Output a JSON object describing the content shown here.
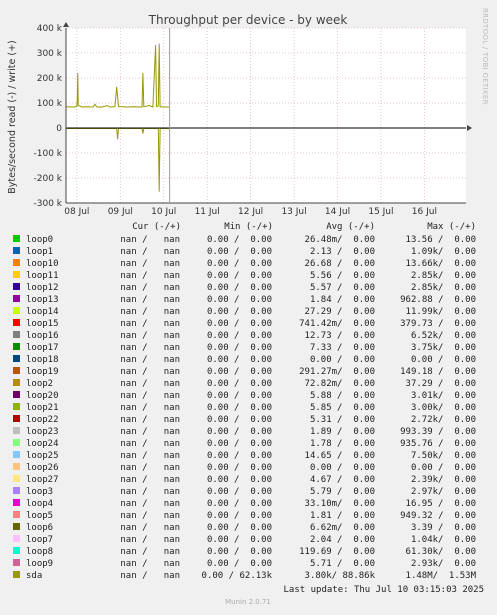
{
  "chart_data": {
    "type": "line",
    "title": "Throughput per device - by week",
    "ylabel": "Bytes/second read (-) / write (+)",
    "watermark": "RRDTOOL / TOBI OETIKER",
    "ylim": [
      -300000,
      400000
    ],
    "y_ticks": [
      {
        "value": 400000,
        "label": "400 k"
      },
      {
        "value": 300000,
        "label": "300 k"
      },
      {
        "value": 200000,
        "label": "200 k"
      },
      {
        "value": 100000,
        "label": "100 k"
      },
      {
        "value": 0,
        "label": "0"
      },
      {
        "value": -100000,
        "label": "-100 k"
      },
      {
        "value": -200000,
        "label": "-200 k"
      },
      {
        "value": -300000,
        "label": "-300 k"
      }
    ],
    "xlim": [
      "2025-07-07T18:00",
      "2025-07-16T23:00"
    ],
    "x_ticks": [
      {
        "value": "2025-07-08",
        "label": "08 Jul"
      },
      {
        "value": "2025-07-09",
        "label": "09 Jul"
      },
      {
        "value": "2025-07-10",
        "label": "10 Jul"
      },
      {
        "value": "2025-07-11",
        "label": "11 Jul"
      },
      {
        "value": "2025-07-12",
        "label": "12 Jul"
      },
      {
        "value": "2025-07-13",
        "label": "13 Jul"
      },
      {
        "value": "2025-07-14",
        "label": "14 Jul"
      },
      {
        "value": "2025-07-15",
        "label": "15 Jul"
      },
      {
        "value": "2025-07-16",
        "label": "16 Jul"
      }
    ],
    "now_marker": "2025-07-10T03:15",
    "grid": true,
    "series": [
      {
        "name": "sda",
        "color": "#999900",
        "write_points": [
          [
            "2025-07-07T18:00",
            85000
          ],
          [
            "2025-07-07T22:00",
            84000
          ],
          [
            "2025-07-08T00:00",
            86000
          ],
          [
            "2025-07-08T00:15",
            120000
          ],
          [
            "2025-07-08T00:30",
            220000
          ],
          [
            "2025-07-08T00:45",
            90000
          ],
          [
            "2025-07-08T03:00",
            84000
          ],
          [
            "2025-07-08T06:00",
            85000
          ],
          [
            "2025-07-08T09:00",
            84000
          ],
          [
            "2025-07-08T10:00",
            95000
          ],
          [
            "2025-07-08T11:00",
            84000
          ],
          [
            "2025-07-08T14:00",
            84000
          ],
          [
            "2025-07-08T17:00",
            90000
          ],
          [
            "2025-07-08T18:00",
            84000
          ],
          [
            "2025-07-08T21:00",
            85000
          ],
          [
            "2025-07-08T22:00",
            165000
          ],
          [
            "2025-07-08T23:00",
            86000
          ],
          [
            "2025-07-09T04:00",
            84000
          ],
          [
            "2025-07-09T08:00",
            85000
          ],
          [
            "2025-07-09T10:00",
            84000
          ],
          [
            "2025-07-09T12:00",
            84000
          ],
          [
            "2025-07-09T12:30",
            220000
          ],
          [
            "2025-07-09T13:00",
            85000
          ],
          [
            "2025-07-09T16:00",
            90000
          ],
          [
            "2025-07-09T18:00",
            84000
          ],
          [
            "2025-07-09T19:30",
            332000
          ],
          [
            "2025-07-09T20:00",
            86000
          ],
          [
            "2025-07-09T21:00",
            88000
          ],
          [
            "2025-07-09T21:30",
            338000
          ],
          [
            "2025-07-09T22:00",
            85000
          ],
          [
            "2025-07-10T00:00",
            84000
          ],
          [
            "2025-07-10T03:00",
            84000
          ]
        ],
        "read_points": [
          [
            "2025-07-07T18:00",
            -2000
          ],
          [
            "2025-07-08T00:00",
            -2000
          ],
          [
            "2025-07-08T22:00",
            -2000
          ],
          [
            "2025-07-08T22:30",
            -45000
          ],
          [
            "2025-07-08T23:00",
            -2000
          ],
          [
            "2025-07-09T12:00",
            -2000
          ],
          [
            "2025-07-09T12:30",
            -22000
          ],
          [
            "2025-07-09T13:00",
            -2000
          ],
          [
            "2025-07-09T21:00",
            -2000
          ],
          [
            "2025-07-09T21:30",
            -255000
          ],
          [
            "2025-07-09T22:00",
            -2000
          ],
          [
            "2025-07-10T00:00",
            -2000
          ],
          [
            "2025-07-10T03:00",
            -2000
          ]
        ]
      }
    ]
  },
  "legend": {
    "col_headers": {
      "cur": "Cur (-/+)",
      "min": "Min (-/+)",
      "avg": "Avg (-/+)",
      "max": "Max (-/+)"
    },
    "rows": [
      {
        "name": "loop0",
        "color": "#00cc00",
        "cur": "nan /   nan",
        "min": "0.00 /  0.00",
        "avg": "26.48m/  0.00",
        "max": "13.56 /  0.00"
      },
      {
        "name": "loop1",
        "color": "#0066b3",
        "cur": "nan /   nan",
        "min": "0.00 /  0.00",
        "avg": "2.13 /  0.00",
        "max": "1.09k/  0.00"
      },
      {
        "name": "loop10",
        "color": "#ff8000",
        "cur": "nan /   nan",
        "min": "0.00 /  0.00",
        "avg": "26.68 /  0.00",
        "max": "13.66k/  0.00"
      },
      {
        "name": "loop11",
        "color": "#ffcc00",
        "cur": "nan /   nan",
        "min": "0.00 /  0.00",
        "avg": "5.56 /  0.00",
        "max": "2.85k/  0.00"
      },
      {
        "name": "loop12",
        "color": "#330099",
        "cur": "nan /   nan",
        "min": "0.00 /  0.00",
        "avg": "5.57 /  0.00",
        "max": "2.85k/  0.00"
      },
      {
        "name": "loop13",
        "color": "#990099",
        "cur": "nan /   nan",
        "min": "0.00 /  0.00",
        "avg": "1.84 /  0.00",
        "max": "962.88 /  0.00"
      },
      {
        "name": "loop14",
        "color": "#ccff00",
        "cur": "nan /   nan",
        "min": "0.00 /  0.00",
        "avg": "27.29 /  0.00",
        "max": "11.99k/  0.00"
      },
      {
        "name": "loop15",
        "color": "#ff0000",
        "cur": "nan /   nan",
        "min": "0.00 /  0.00",
        "avg": "741.42m/  0.00",
        "max": "379.73 /  0.00"
      },
      {
        "name": "loop16",
        "color": "#808080",
        "cur": "nan /   nan",
        "min": "0.00 /  0.00",
        "avg": "12.73 /  0.00",
        "max": "6.52k/  0.00"
      },
      {
        "name": "loop17",
        "color": "#008f00",
        "cur": "nan /   nan",
        "min": "0.00 /  0.00",
        "avg": "7.33 /  0.00",
        "max": "3.75k/  0.00"
      },
      {
        "name": "loop18",
        "color": "#00487d",
        "cur": "nan /   nan",
        "min": "0.00 /  0.00",
        "avg": "0.00 /  0.00",
        "max": "0.00 /  0.00"
      },
      {
        "name": "loop19",
        "color": "#b35a00",
        "cur": "nan /   nan",
        "min": "0.00 /  0.00",
        "avg": "291.27m/  0.00",
        "max": "149.18 /  0.00"
      },
      {
        "name": "loop2",
        "color": "#b38f00",
        "cur": "nan /   nan",
        "min": "0.00 /  0.00",
        "avg": "72.82m/  0.00",
        "max": "37.29 /  0.00"
      },
      {
        "name": "loop20",
        "color": "#6b006b",
        "cur": "nan /   nan",
        "min": "0.00 /  0.00",
        "avg": "5.88 /  0.00",
        "max": "3.01k/  0.00"
      },
      {
        "name": "loop21",
        "color": "#8fb300",
        "cur": "nan /   nan",
        "min": "0.00 /  0.00",
        "avg": "5.85 /  0.00",
        "max": "3.00k/  0.00"
      },
      {
        "name": "loop22",
        "color": "#b30000",
        "cur": "nan /   nan",
        "min": "0.00 /  0.00",
        "avg": "5.31 /  0.00",
        "max": "2.72k/  0.00"
      },
      {
        "name": "loop23",
        "color": "#bebebe",
        "cur": "nan /   nan",
        "min": "0.00 /  0.00",
        "avg": "1.89 /  0.00",
        "max": "993.39 /  0.00"
      },
      {
        "name": "loop24",
        "color": "#80ff80",
        "cur": "nan /   nan",
        "min": "0.00 /  0.00",
        "avg": "1.78 /  0.00",
        "max": "935.76 /  0.00"
      },
      {
        "name": "loop25",
        "color": "#80c9ff",
        "cur": "nan /   nan",
        "min": "0.00 /  0.00",
        "avg": "14.65 /  0.00",
        "max": "7.50k/  0.00"
      },
      {
        "name": "loop26",
        "color": "#ffc080",
        "cur": "nan /   nan",
        "min": "0.00 /  0.00",
        "avg": "0.00 /  0.00",
        "max": "0.00 /  0.00"
      },
      {
        "name": "loop27",
        "color": "#ffe680",
        "cur": "nan /   nan",
        "min": "0.00 /  0.00",
        "avg": "4.67 /  0.00",
        "max": "2.39k/  0.00"
      },
      {
        "name": "loop3",
        "color": "#aa80ff",
        "cur": "nan /   nan",
        "min": "0.00 /  0.00",
        "avg": "5.79 /  0.00",
        "max": "2.97k/  0.00"
      },
      {
        "name": "loop4",
        "color": "#ee00cc",
        "cur": "nan /   nan",
        "min": "0.00 /  0.00",
        "avg": "33.10m/  0.00",
        "max": "16.95 /  0.00"
      },
      {
        "name": "loop5",
        "color": "#ff8080",
        "cur": "nan /   nan",
        "min": "0.00 /  0.00",
        "avg": "1.81 /  0.00",
        "max": "949.32 /  0.00"
      },
      {
        "name": "loop6",
        "color": "#666600",
        "cur": "nan /   nan",
        "min": "0.00 /  0.00",
        "avg": "6.62m/  0.00",
        "max": "3.39 /  0.00"
      },
      {
        "name": "loop7",
        "color": "#ffbfff",
        "cur": "nan /   nan",
        "min": "0.00 /  0.00",
        "avg": "2.04 /  0.00",
        "max": "1.04k/  0.00"
      },
      {
        "name": "loop8",
        "color": "#00ffcc",
        "cur": "nan /   nan",
        "min": "0.00 /  0.00",
        "avg": "119.69 /  0.00",
        "max": "61.30k/  0.00"
      },
      {
        "name": "loop9",
        "color": "#cc6699",
        "cur": "nan /   nan",
        "min": "0.00 /  0.00",
        "avg": "5.71 /  0.00",
        "max": "2.93k/  0.00"
      },
      {
        "name": "sda",
        "color": "#999900",
        "cur": "nan /   nan",
        "min": "0.00 / 62.13k",
        "avg": "3.80k/ 88.86k",
        "max": "1.48M/  1.53M"
      }
    ]
  },
  "last_update": "Last update: Thu Jul 10 03:15:03 2025",
  "footer": "Munin 2.0.71"
}
